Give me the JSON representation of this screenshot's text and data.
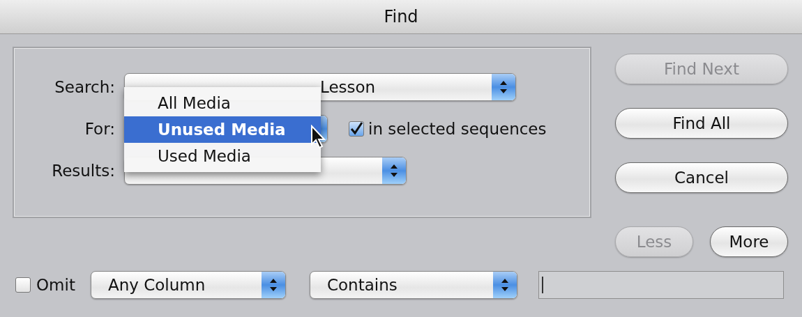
{
  "window": {
    "title": "Find"
  },
  "search": {
    "label": "Search:",
    "value": "Lesson"
  },
  "for": {
    "label": "For:",
    "checkbox": {
      "label": "in selected sequences",
      "checked": true
    }
  },
  "results": {
    "label": "Results:"
  },
  "menu": {
    "items": [
      {
        "label": "All Media",
        "selected": false
      },
      {
        "label": "Unused Media",
        "selected": true
      },
      {
        "label": "Used Media",
        "selected": false
      }
    ]
  },
  "buttons": [
    {
      "label": "Find Next",
      "disabled": true
    },
    {
      "label": "Find All",
      "disabled": false
    },
    {
      "label": "Cancel",
      "disabled": false
    }
  ],
  "size_buttons": [
    {
      "label": "Less",
      "disabled": true
    },
    {
      "label": "More",
      "disabled": false
    }
  ],
  "filter": {
    "omit": {
      "label": "Omit",
      "checked": false
    },
    "column": "Any Column",
    "match": "Contains"
  }
}
